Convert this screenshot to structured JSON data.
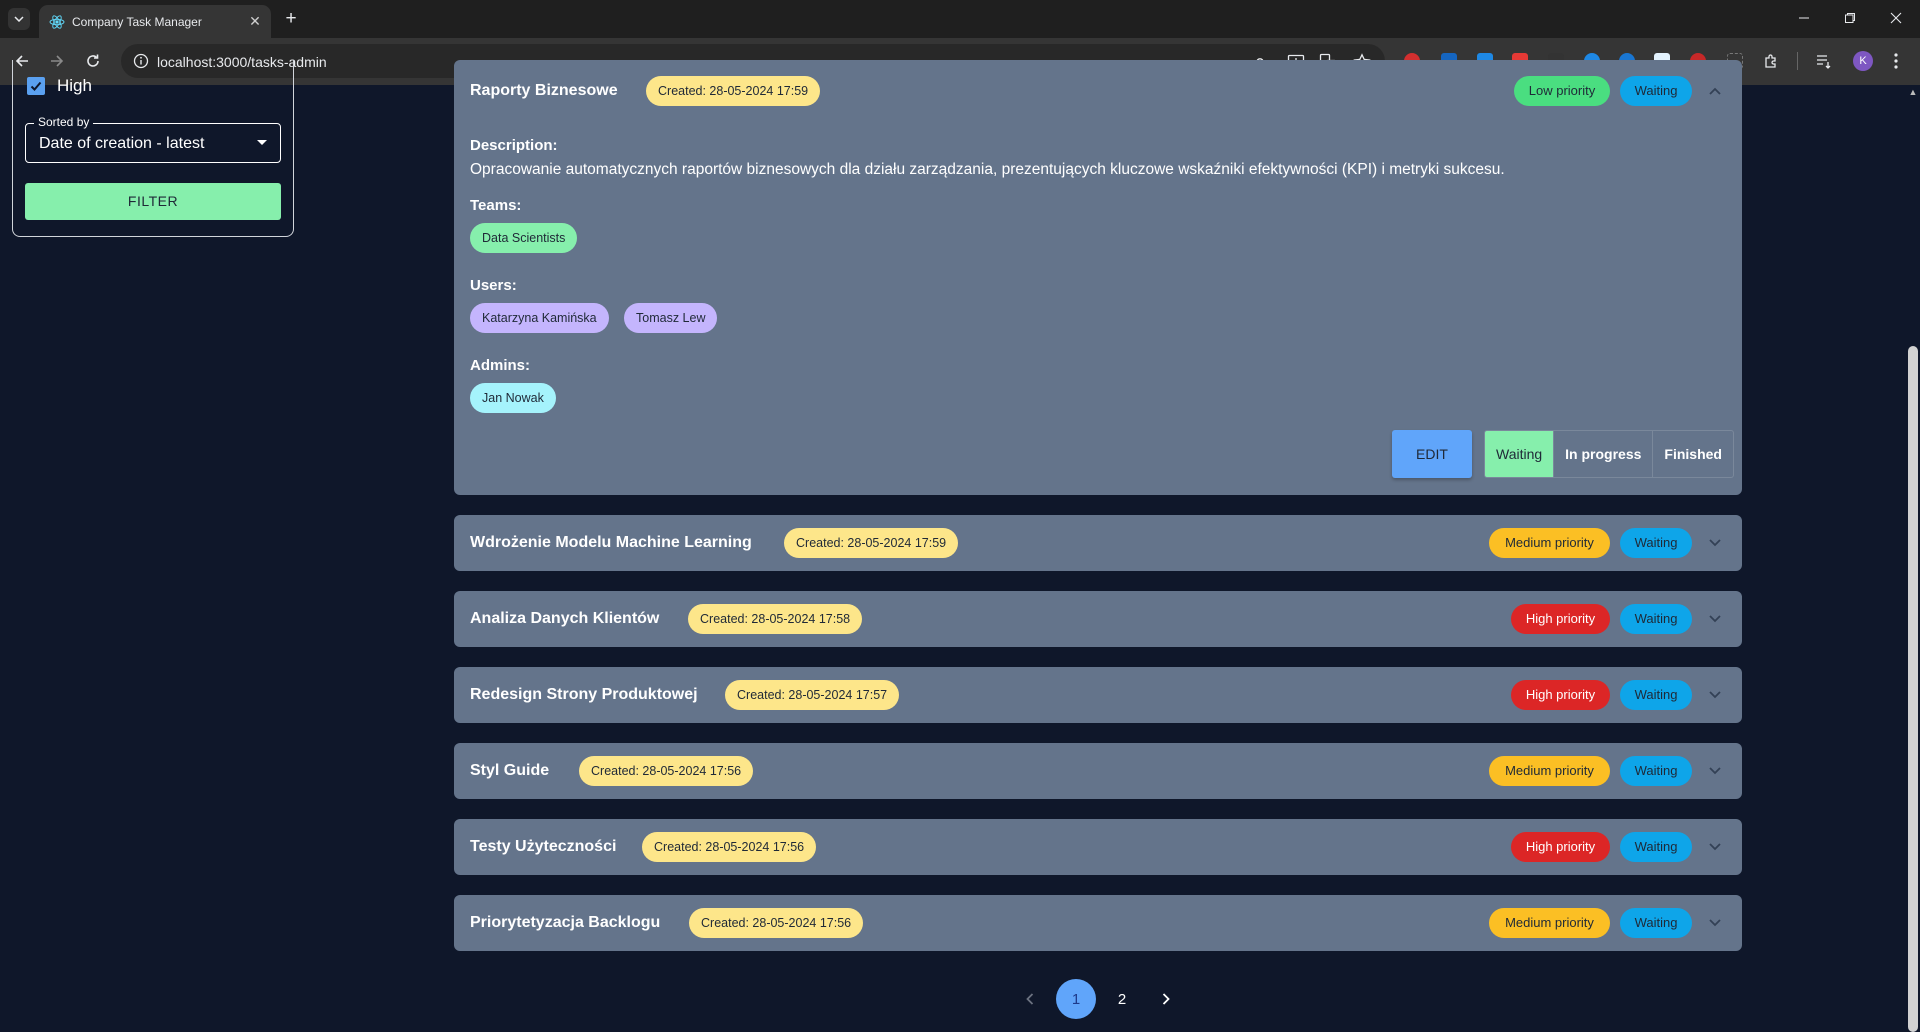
{
  "browser": {
    "tab_title": "Company Task Manager",
    "url": "localhost:3000/tasks-admin",
    "profile_initial": "K"
  },
  "filters": {
    "priority_checkbox_label": "High",
    "priority_checked": true,
    "sort_label": "Sorted by",
    "sort_value": "Date of creation - latest",
    "filter_button": "FILTER"
  },
  "expanded_task": {
    "title": "Raporty Biznesowe",
    "created": "Created: 28-05-2024 17:59",
    "priority": "Low priority",
    "status": "Waiting",
    "description_label": "Description:",
    "description": "Opracowanie automatycznych raportów biznesowych dla działu zarządzania, prezentujących kluczowe wskaźniki efektywności (KPI) i metryki sukcesu.",
    "teams_label": "Teams:",
    "teams": [
      "Data Scientists"
    ],
    "users_label": "Users:",
    "users": [
      "Katarzyna Kamińska",
      "Tomasz Lew"
    ],
    "admins_label": "Admins:",
    "admins": [
      "Jan Nowak"
    ],
    "edit_button": "EDIT",
    "status_options": [
      "Waiting",
      "In progress",
      "Finished"
    ],
    "active_status": "Waiting"
  },
  "tasks": [
    {
      "title": "Wdrożenie Modelu Machine Learning",
      "created": "Created: 28-05-2024 17:59",
      "priority": "Medium priority",
      "status": "Waiting"
    },
    {
      "title": "Analiza Danych Klientów",
      "created": "Created: 28-05-2024 17:58",
      "priority": "High priority",
      "status": "Waiting"
    },
    {
      "title": "Redesign Strony Produktowej",
      "created": "Created: 28-05-2024 17:57",
      "priority": "High priority",
      "status": "Waiting"
    },
    {
      "title": "Styl Guide",
      "created": "Created: 28-05-2024 17:56",
      "priority": "Medium priority",
      "status": "Waiting"
    },
    {
      "title": "Testy Użyteczności",
      "created": "Created: 28-05-2024 17:56",
      "priority": "High priority",
      "status": "Waiting"
    },
    {
      "title": "Priorytetyzacja Backlogu",
      "created": "Created: 28-05-2024 17:56",
      "priority": "Medium priority",
      "status": "Waiting"
    }
  ],
  "pagination": {
    "pages": [
      "1",
      "2"
    ],
    "current": "1"
  },
  "colors": {
    "page_bg": "#0f172a",
    "card_bg": "#64748b",
    "created_badge": "#fde68a",
    "low_priority": "#4ade80",
    "medium_priority": "#fbbf24",
    "high_priority": "#dc2626",
    "waiting": "#0ea5e9",
    "accent_blue": "#60a5fa",
    "filter_green": "#86efac"
  }
}
